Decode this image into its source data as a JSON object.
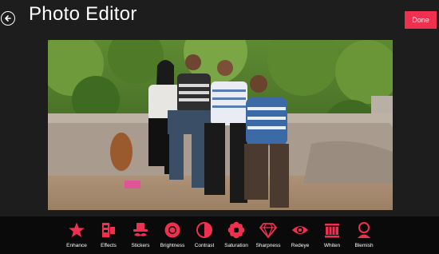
{
  "header": {
    "title": "Photo Editor",
    "done_label": "Done"
  },
  "colors": {
    "accent": "#f0304f",
    "background": "#1d1d1d",
    "toolbar_bg": "#0a0a0a"
  },
  "toolbar": {
    "items": [
      {
        "label": "Enhance",
        "icon": "star-icon"
      },
      {
        "label": "Effects",
        "icon": "effects-icon"
      },
      {
        "label": "Stickers",
        "icon": "hat-mustache-icon"
      },
      {
        "label": "Brightness",
        "icon": "sun-icon"
      },
      {
        "label": "Contrast",
        "icon": "contrast-icon"
      },
      {
        "label": "Saturation",
        "icon": "flower-icon"
      },
      {
        "label": "Sharpness",
        "icon": "diamond-icon"
      },
      {
        "label": "Redeye",
        "icon": "eye-icon"
      },
      {
        "label": "Whiten",
        "icon": "teeth-icon"
      },
      {
        "label": "Blemish",
        "icon": "person-icon"
      }
    ]
  }
}
